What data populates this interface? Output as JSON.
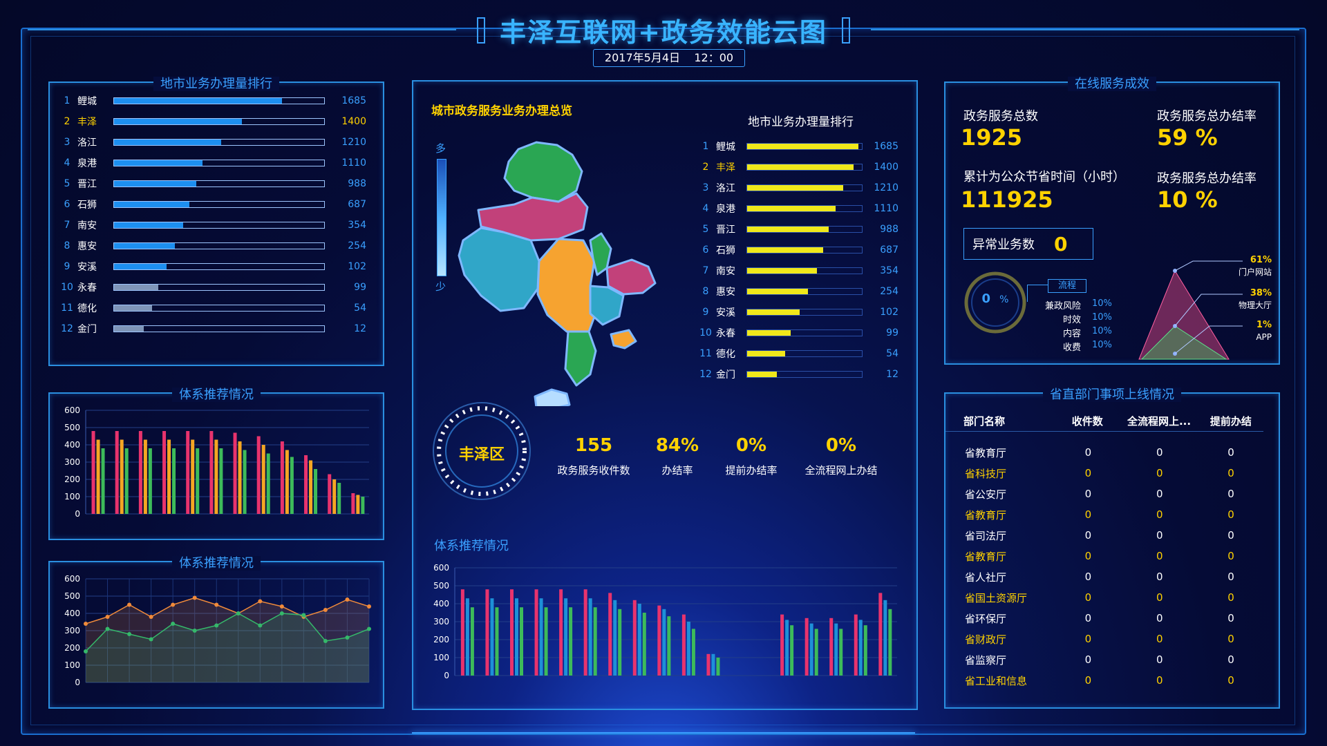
{
  "header": {
    "title": "丰泽互联网+政务效能云图",
    "datetime": "2017年5月4日    12：00"
  },
  "left_rank": {
    "title": "地市业务办理量排行",
    "rows": [
      {
        "rank": "1",
        "name": "鲤城",
        "value": "1685",
        "pct": 0.8
      },
      {
        "rank": "2",
        "name": "丰泽",
        "value": "1400",
        "pct": 0.61
      },
      {
        "rank": "3",
        "name": "洛江",
        "value": "1210",
        "pct": 0.51
      },
      {
        "rank": "4",
        "name": "泉港",
        "value": "1110",
        "pct": 0.42
      },
      {
        "rank": "5",
        "name": "晋江",
        "value": "988",
        "pct": 0.39
      },
      {
        "rank": "6",
        "name": "石狮",
        "value": "687",
        "pct": 0.36
      },
      {
        "rank": "7",
        "name": "南安",
        "value": "354",
        "pct": 0.33
      },
      {
        "rank": "8",
        "name": "惠安",
        "value": "254",
        "pct": 0.29
      },
      {
        "rank": "9",
        "name": "安溪",
        "value": "102",
        "pct": 0.25
      },
      {
        "rank": "10",
        "name": "永春",
        "value": "99",
        "pct": 0.21
      },
      {
        "rank": "11",
        "name": "德化",
        "value": "54",
        "pct": 0.18
      },
      {
        "rank": "12",
        "name": "金门",
        "value": "12",
        "pct": 0.14
      }
    ]
  },
  "left_bar": {
    "title": "体系推荐情况",
    "yticks": [
      "600",
      "500",
      "400",
      "300",
      "200",
      "100",
      "0"
    ]
  },
  "left_line": {
    "title": "体系推荐情况",
    "yticks": [
      "600",
      "500",
      "400",
      "300",
      "200",
      "100",
      "0"
    ]
  },
  "center": {
    "overview_title": "城市政务服务业务办理总览",
    "legend_high": "多",
    "legend_low": "少",
    "rank_title": "地市业务办理量排行",
    "rank_rows": [
      {
        "rank": "1",
        "name": "鲤城",
        "value": "1685",
        "pct": 0.97
      },
      {
        "rank": "2",
        "name": "丰泽",
        "value": "1400",
        "pct": 0.93
      },
      {
        "rank": "3",
        "name": "洛江",
        "value": "1210",
        "pct": 0.84
      },
      {
        "rank": "4",
        "name": "泉港",
        "value": "1110",
        "pct": 0.77
      },
      {
        "rank": "5",
        "name": "晋江",
        "value": "988",
        "pct": 0.71
      },
      {
        "rank": "6",
        "name": "石狮",
        "value": "687",
        "pct": 0.66
      },
      {
        "rank": "7",
        "name": "南安",
        "value": "354",
        "pct": 0.61
      },
      {
        "rank": "8",
        "name": "惠安",
        "value": "254",
        "pct": 0.53
      },
      {
        "rank": "9",
        "name": "安溪",
        "value": "102",
        "pct": 0.46
      },
      {
        "rank": "10",
        "name": "永春",
        "value": "99",
        "pct": 0.38
      },
      {
        "rank": "11",
        "name": "德化",
        "value": "54",
        "pct": 0.33
      },
      {
        "rank": "12",
        "name": "金门",
        "value": "12",
        "pct": 0.26
      }
    ],
    "district": "丰泽区",
    "stats": [
      {
        "value": "155",
        "label": "政务服务收件数"
      },
      {
        "value": "84%",
        "label": "办结率"
      },
      {
        "value": "0%",
        "label": "提前办结率"
      },
      {
        "value": "0%",
        "label": "全流程网上办结"
      }
    ],
    "bar_title": "体系推荐情况",
    "yticks": [
      "600",
      "500",
      "400",
      "300",
      "200",
      "100",
      "0"
    ]
  },
  "right_top": {
    "title": "在线服务成效",
    "total_label": "政务服务总数",
    "total_value": "1925",
    "rate1_label": "政务服务总办结率",
    "rate1_value": "59 %",
    "saved_label": "累计为公众节省时间（小时）",
    "saved_value": "111925",
    "rate2_label": "政务服务总办结率",
    "rate2_value": "10 %",
    "abnormal_label": "异常业务数",
    "abnormal_value": "0",
    "gauge_value": "0",
    "gauge_unit": "%",
    "process_label": "流程",
    "process_items": [
      {
        "label": "兼政风险",
        "value": "10%"
      },
      {
        "label": "时效",
        "value": "10%"
      },
      {
        "label": "内容",
        "value": "10%"
      },
      {
        "label": "收费",
        "value": "10%"
      }
    ],
    "channels": [
      {
        "pct": "61%",
        "name": "门户网站"
      },
      {
        "pct": "38%",
        "name": "物理大厅"
      },
      {
        "pct": "1%",
        "name": "APP"
      }
    ]
  },
  "right_table": {
    "title": "省直部门事项上线情况",
    "headers": [
      "部门名称",
      "收件数",
      "全流程网上...",
      "提前办结"
    ],
    "rows": [
      {
        "name": "省教育厅",
        "a": "0",
        "b": "0",
        "c": "0",
        "hl": false
      },
      {
        "name": "省科技厅",
        "a": "0",
        "b": "0",
        "c": "0",
        "hl": true
      },
      {
        "name": "省公安厅",
        "a": "0",
        "b": "0",
        "c": "0",
        "hl": false
      },
      {
        "name": "省教育厅",
        "a": "0",
        "b": "0",
        "c": "0",
        "hl": true
      },
      {
        "name": "省司法厅",
        "a": "0",
        "b": "0",
        "c": "0",
        "hl": false
      },
      {
        "name": "省教育厅",
        "a": "0",
        "b": "0",
        "c": "0",
        "hl": true
      },
      {
        "name": "省人社厅",
        "a": "0",
        "b": "0",
        "c": "0",
        "hl": false
      },
      {
        "name": "省国土资源厅",
        "a": "0",
        "b": "0",
        "c": "0",
        "hl": true
      },
      {
        "name": "省环保厅",
        "a": "0",
        "b": "0",
        "c": "0",
        "hl": false
      },
      {
        "name": "省财政厅",
        "a": "0",
        "b": "0",
        "c": "0",
        "hl": true
      },
      {
        "name": "省监察厅",
        "a": "0",
        "b": "0",
        "c": "0",
        "hl": false
      },
      {
        "name": "省工业和信息",
        "a": "0",
        "b": "0",
        "c": "0",
        "hl": true
      }
    ]
  },
  "chart_data": [
    {
      "type": "bar",
      "title": "体系推荐情况",
      "ylim": [
        0,
        600
      ],
      "categories": [
        "",
        "",
        "",
        "",
        "",
        "",
        "",
        "",
        "",
        "",
        "",
        ""
      ],
      "series": [
        {
          "color": "#e8336d",
          "values": [
            480,
            480,
            480,
            480,
            480,
            480,
            470,
            450,
            420,
            340,
            230,
            120
          ]
        },
        {
          "color": "#f5a623",
          "values": [
            430,
            430,
            430,
            430,
            430,
            430,
            420,
            400,
            370,
            310,
            200,
            110
          ]
        },
        {
          "color": "#3dbb5a",
          "values": [
            380,
            380,
            380,
            380,
            380,
            380,
            370,
            350,
            330,
            260,
            180,
            100
          ]
        }
      ]
    },
    {
      "type": "area",
      "title": "体系推荐情况",
      "ylim": [
        0,
        600
      ],
      "series": [
        {
          "color": "#f08a3a",
          "values": [
            340,
            380,
            450,
            380,
            450,
            490,
            450,
            400,
            470,
            440,
            380,
            420,
            480,
            440
          ]
        },
        {
          "color": "#35b86a",
          "values": [
            180,
            310,
            280,
            250,
            340,
            300,
            330,
            400,
            330,
            400,
            390,
            240,
            260,
            310
          ]
        }
      ]
    },
    {
      "type": "bar",
      "title": "体系推荐情况",
      "ylim": [
        0,
        600
      ],
      "categories": [
        "",
        "",
        "",
        "",
        "",
        "",
        "",
        "",
        "",
        "",
        "",
        "",
        "",
        "",
        "",
        "",
        "",
        ""
      ],
      "series": [
        {
          "color": "#e8336d",
          "values": [
            480,
            480,
            480,
            480,
            480,
            480,
            460,
            420,
            390,
            340,
            120,
            0,
            0,
            340,
            320,
            320,
            340,
            460
          ]
        },
        {
          "color": "#1e90d8",
          "values": [
            430,
            430,
            430,
            430,
            430,
            430,
            420,
            400,
            370,
            300,
            120,
            0,
            0,
            310,
            290,
            290,
            310,
            420
          ]
        },
        {
          "color": "#3dbb5a",
          "values": [
            380,
            380,
            380,
            380,
            380,
            380,
            370,
            350,
            330,
            260,
            100,
            0,
            0,
            280,
            260,
            260,
            280,
            370
          ]
        }
      ]
    },
    {
      "type": "pie",
      "categories": [
        "门户网站",
        "物理大厅",
        "APP"
      ],
      "values": [
        61,
        38,
        1
      ]
    }
  ]
}
